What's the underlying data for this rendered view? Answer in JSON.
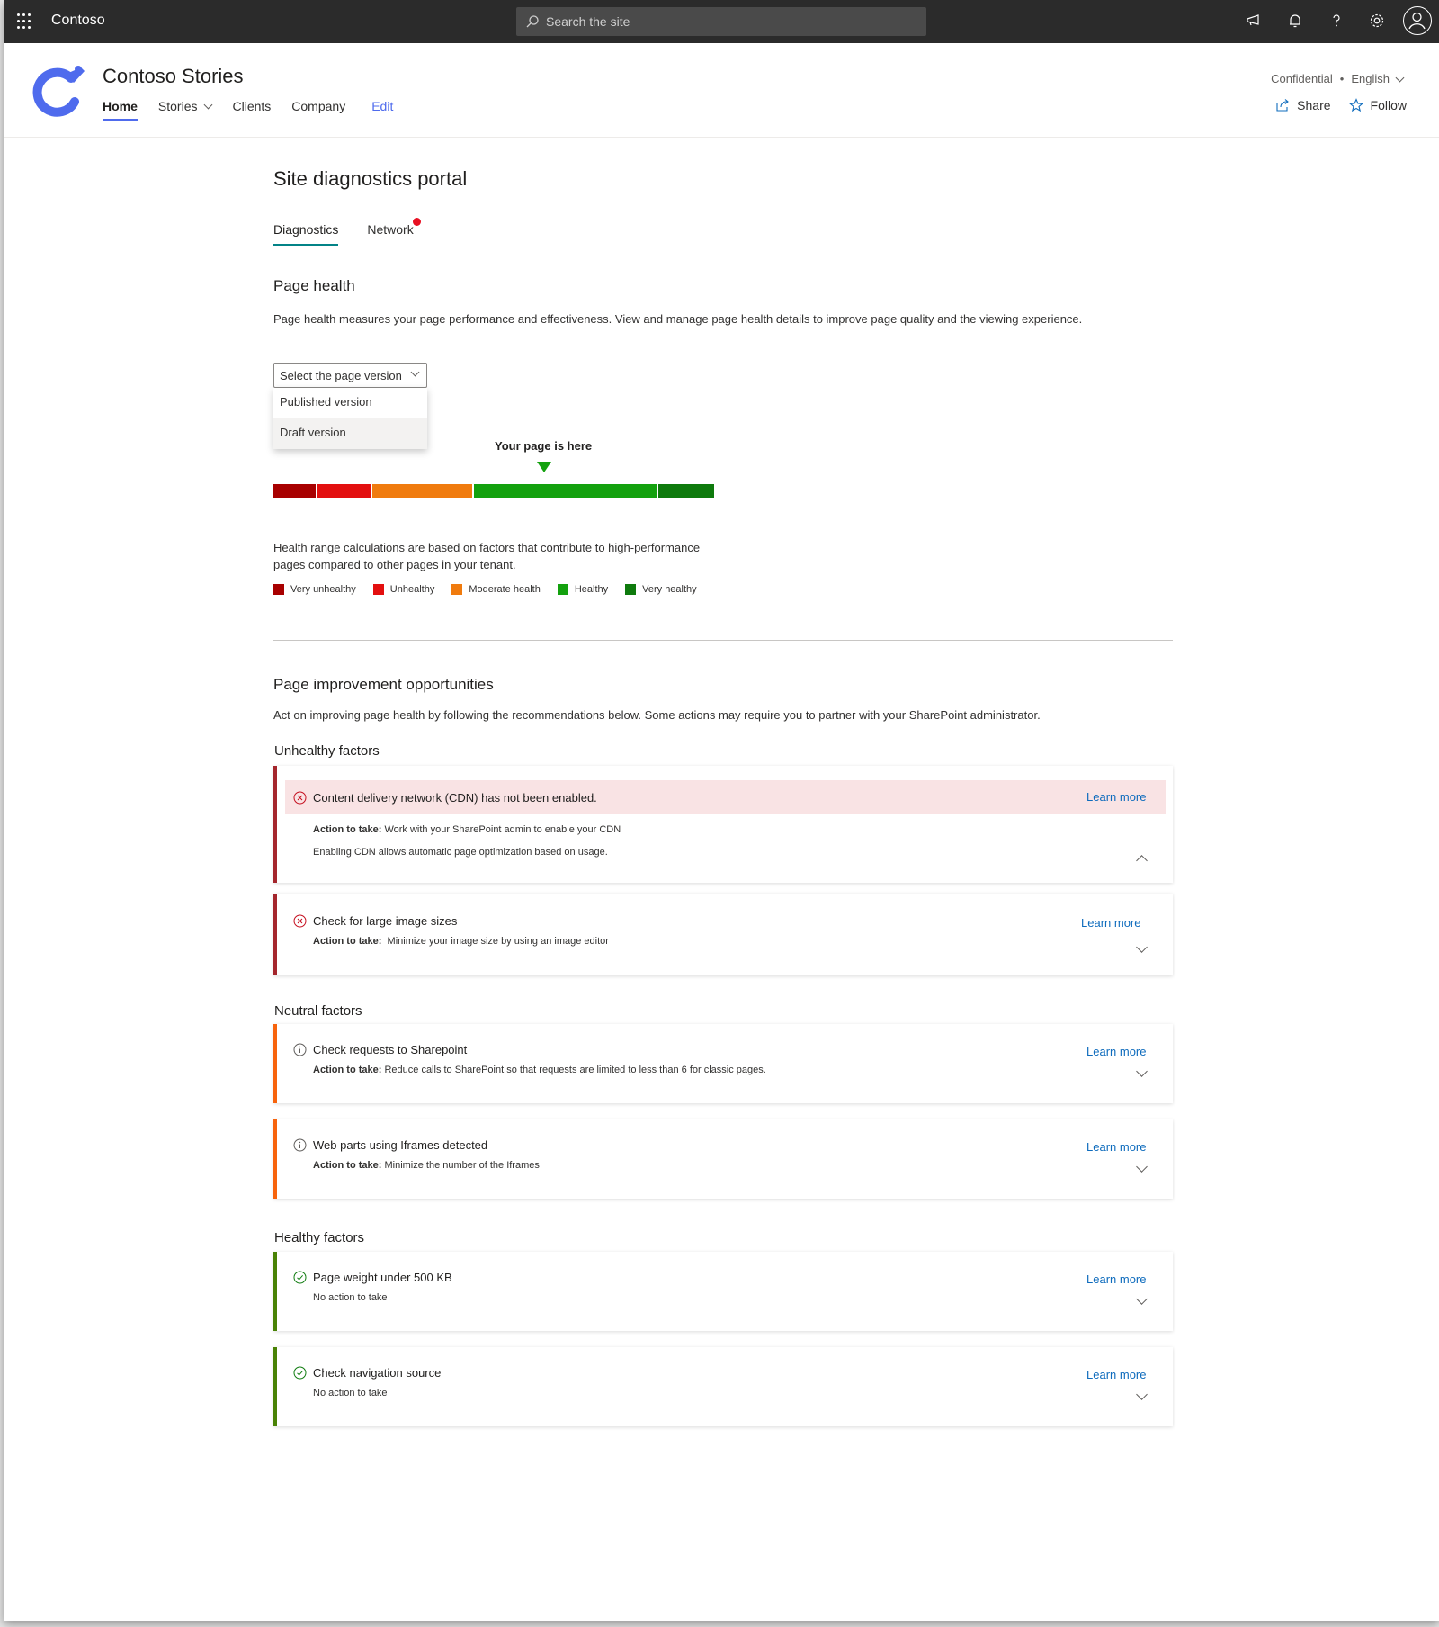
{
  "suitebar": {
    "brand": "Contoso",
    "search_placeholder": "Search the site"
  },
  "site": {
    "title": "Contoso Stories",
    "nav": [
      {
        "label": "Home",
        "active": true
      },
      {
        "label": "Stories",
        "has_dropdown": true
      },
      {
        "label": "Clients"
      },
      {
        "label": "Company"
      },
      {
        "label": "Edit"
      }
    ],
    "classification": "Confidential",
    "separator": "•",
    "language": "English",
    "share_label": "Share",
    "follow_label": "Follow"
  },
  "portal": {
    "title": "Site diagnostics portal",
    "tabs": [
      {
        "label": "Diagnostics",
        "active": true
      },
      {
        "label": "Network",
        "notification": true
      }
    ]
  },
  "page_health": {
    "heading": "Page health",
    "description": "Page health measures your page performance and effectiveness. View and manage page health details to improve page quality and the viewing experience.",
    "dropdown": {
      "placeholder": "Select the page version",
      "options": [
        "Published version",
        "Draft version"
      ],
      "highlighted_option": "Draft version"
    },
    "indicator_label": "Your page is here",
    "indicator_position_fraction": 0.61,
    "range_note_line1": "Health range calculations are based on factors that contribute to high-performance",
    "range_note_line2": "pages compared to other pages in your tenant.",
    "segments": [
      {
        "name": "Very unhealthy",
        "color": "#a80000",
        "share": 0.095
      },
      {
        "name": "Unhealthy",
        "color": "#e30f0f",
        "share": 0.12
      },
      {
        "name": "Moderate health",
        "color": "#f07b0e",
        "share": 0.225
      },
      {
        "name": "Healthy",
        "color": "#13a10e",
        "share": 0.41
      },
      {
        "name": "Very healthy",
        "color": "#0e7a0d",
        "share": 0.125
      }
    ]
  },
  "improvements": {
    "heading": "Page improvement opportunities",
    "description": "Act on improving page health by following the recommendations below. Some actions may require you to partner with your SharePoint administrator.",
    "groups": [
      {
        "heading": "Unhealthy factors",
        "items": [
          {
            "title": "Content delivery network  (CDN) has not been enabled.",
            "learn_more": "Learn more",
            "action_label": "Action to take:",
            "action_text": "Work with your SharePoint admin to enable your CDN",
            "detail": "Enabling CDN allows automatic page optimization based on usage.",
            "expanded": true
          },
          {
            "title": "Check for large image sizes",
            "learn_more": "Learn more",
            "action_label": "Action to take:",
            "action_text": "Minimize your image size by using an image editor"
          }
        ]
      },
      {
        "heading": "Neutral factors",
        "items": [
          {
            "title": "Check requests to Sharepoint",
            "learn_more": "Learn more",
            "action_label": "Action to take:",
            "action_text": "Reduce calls to SharePoint so that requests are limited to less than 6 for classic pages."
          },
          {
            "title": "Web parts using Iframes detected",
            "learn_more": "Learn more",
            "action_label": "Action to take:",
            "action_text": "Minimize the number of the Iframes"
          }
        ]
      },
      {
        "heading": "Healthy factors",
        "items": [
          {
            "title": "Page weight under 500 KB",
            "learn_more": "Learn more",
            "action_text": "No action to take"
          },
          {
            "title": "Check navigation source",
            "learn_more": "Learn more",
            "action_text": "No action to take"
          }
        ]
      }
    ]
  }
}
